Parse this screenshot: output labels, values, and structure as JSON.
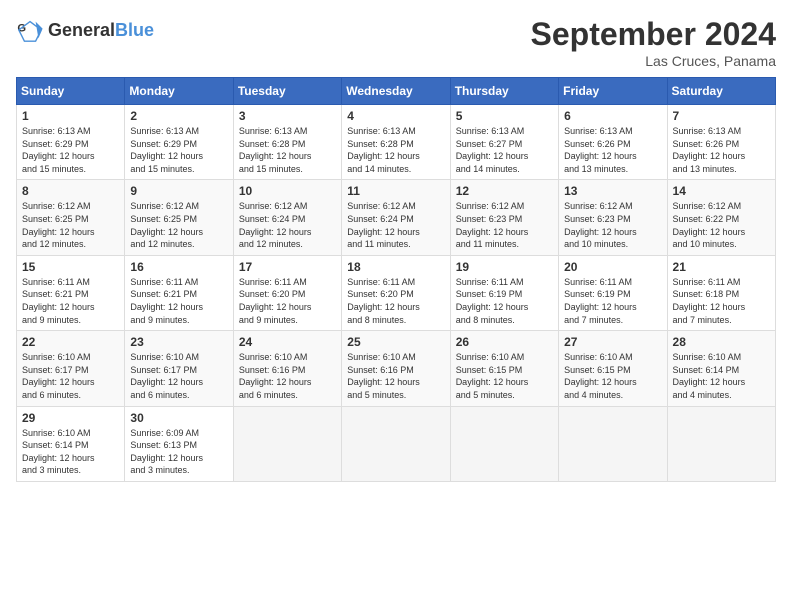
{
  "header": {
    "logo_general": "General",
    "logo_blue": "Blue",
    "month_title": "September 2024",
    "location": "Las Cruces, Panama"
  },
  "days_of_week": [
    "Sunday",
    "Monday",
    "Tuesday",
    "Wednesday",
    "Thursday",
    "Friday",
    "Saturday"
  ],
  "weeks": [
    [
      {
        "day": "1",
        "sunrise": "6:13 AM",
        "sunset": "6:29 PM",
        "daylight": "12 hours and 15 minutes."
      },
      {
        "day": "2",
        "sunrise": "6:13 AM",
        "sunset": "6:29 PM",
        "daylight": "12 hours and 15 minutes."
      },
      {
        "day": "3",
        "sunrise": "6:13 AM",
        "sunset": "6:28 PM",
        "daylight": "12 hours and 15 minutes."
      },
      {
        "day": "4",
        "sunrise": "6:13 AM",
        "sunset": "6:28 PM",
        "daylight": "12 hours and 14 minutes."
      },
      {
        "day": "5",
        "sunrise": "6:13 AM",
        "sunset": "6:27 PM",
        "daylight": "12 hours and 14 minutes."
      },
      {
        "day": "6",
        "sunrise": "6:13 AM",
        "sunset": "6:26 PM",
        "daylight": "12 hours and 13 minutes."
      },
      {
        "day": "7",
        "sunrise": "6:13 AM",
        "sunset": "6:26 PM",
        "daylight": "12 hours and 13 minutes."
      }
    ],
    [
      {
        "day": "8",
        "sunrise": "6:12 AM",
        "sunset": "6:25 PM",
        "daylight": "12 hours and 12 minutes."
      },
      {
        "day": "9",
        "sunrise": "6:12 AM",
        "sunset": "6:25 PM",
        "daylight": "12 hours and 12 minutes."
      },
      {
        "day": "10",
        "sunrise": "6:12 AM",
        "sunset": "6:24 PM",
        "daylight": "12 hours and 12 minutes."
      },
      {
        "day": "11",
        "sunrise": "6:12 AM",
        "sunset": "6:24 PM",
        "daylight": "12 hours and 11 minutes."
      },
      {
        "day": "12",
        "sunrise": "6:12 AM",
        "sunset": "6:23 PM",
        "daylight": "12 hours and 11 minutes."
      },
      {
        "day": "13",
        "sunrise": "6:12 AM",
        "sunset": "6:23 PM",
        "daylight": "12 hours and 10 minutes."
      },
      {
        "day": "14",
        "sunrise": "6:12 AM",
        "sunset": "6:22 PM",
        "daylight": "12 hours and 10 minutes."
      }
    ],
    [
      {
        "day": "15",
        "sunrise": "6:11 AM",
        "sunset": "6:21 PM",
        "daylight": "12 hours and 9 minutes."
      },
      {
        "day": "16",
        "sunrise": "6:11 AM",
        "sunset": "6:21 PM",
        "daylight": "12 hours and 9 minutes."
      },
      {
        "day": "17",
        "sunrise": "6:11 AM",
        "sunset": "6:20 PM",
        "daylight": "12 hours and 9 minutes."
      },
      {
        "day": "18",
        "sunrise": "6:11 AM",
        "sunset": "6:20 PM",
        "daylight": "12 hours and 8 minutes."
      },
      {
        "day": "19",
        "sunrise": "6:11 AM",
        "sunset": "6:19 PM",
        "daylight": "12 hours and 8 minutes."
      },
      {
        "day": "20",
        "sunrise": "6:11 AM",
        "sunset": "6:19 PM",
        "daylight": "12 hours and 7 minutes."
      },
      {
        "day": "21",
        "sunrise": "6:11 AM",
        "sunset": "6:18 PM",
        "daylight": "12 hours and 7 minutes."
      }
    ],
    [
      {
        "day": "22",
        "sunrise": "6:10 AM",
        "sunset": "6:17 PM",
        "daylight": "12 hours and 6 minutes."
      },
      {
        "day": "23",
        "sunrise": "6:10 AM",
        "sunset": "6:17 PM",
        "daylight": "12 hours and 6 minutes."
      },
      {
        "day": "24",
        "sunrise": "6:10 AM",
        "sunset": "6:16 PM",
        "daylight": "12 hours and 6 minutes."
      },
      {
        "day": "25",
        "sunrise": "6:10 AM",
        "sunset": "6:16 PM",
        "daylight": "12 hours and 5 minutes."
      },
      {
        "day": "26",
        "sunrise": "6:10 AM",
        "sunset": "6:15 PM",
        "daylight": "12 hours and 5 minutes."
      },
      {
        "day": "27",
        "sunrise": "6:10 AM",
        "sunset": "6:15 PM",
        "daylight": "12 hours and 4 minutes."
      },
      {
        "day": "28",
        "sunrise": "6:10 AM",
        "sunset": "6:14 PM",
        "daylight": "12 hours and 4 minutes."
      }
    ],
    [
      {
        "day": "29",
        "sunrise": "6:10 AM",
        "sunset": "6:14 PM",
        "daylight": "12 hours and 3 minutes."
      },
      {
        "day": "30",
        "sunrise": "6:09 AM",
        "sunset": "6:13 PM",
        "daylight": "12 hours and 3 minutes."
      },
      null,
      null,
      null,
      null,
      null
    ]
  ]
}
